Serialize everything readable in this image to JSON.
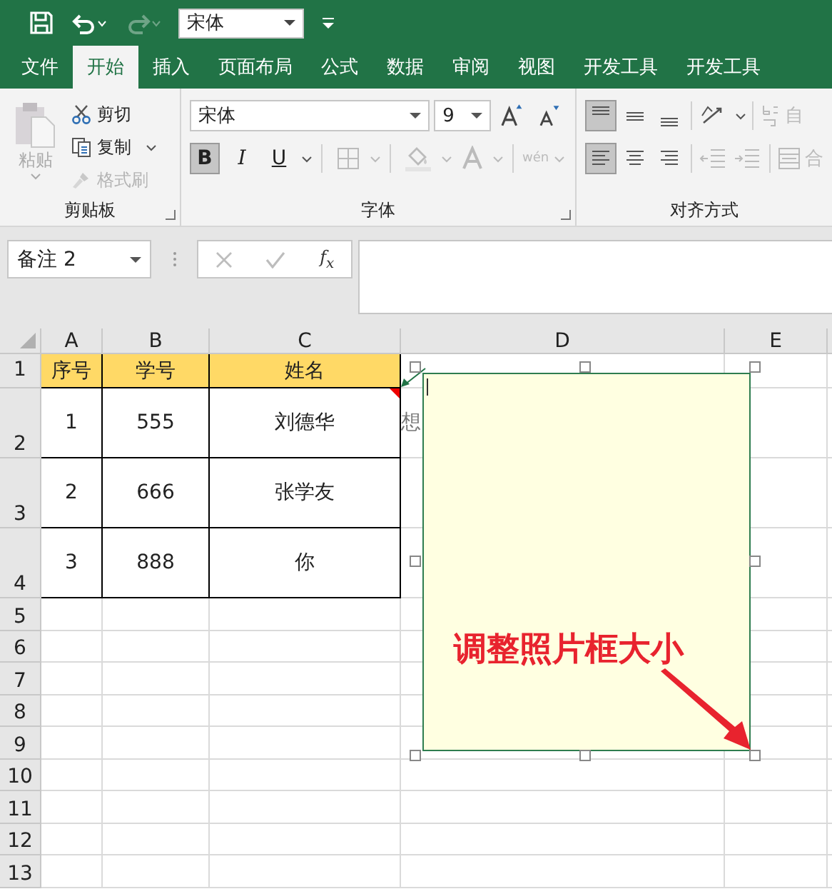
{
  "quick_access": {
    "font": "宋体",
    "redo_disabled": true
  },
  "tabs": [
    {
      "label": "文件",
      "selected": false
    },
    {
      "label": "开始",
      "selected": true
    },
    {
      "label": "插入",
      "selected": false
    },
    {
      "label": "页面布局",
      "selected": false
    },
    {
      "label": "公式",
      "selected": false
    },
    {
      "label": "数据",
      "selected": false
    },
    {
      "label": "审阅",
      "selected": false
    },
    {
      "label": "视图",
      "selected": false
    },
    {
      "label": "开发工具",
      "selected": false
    },
    {
      "label": "开发工具",
      "selected": false
    }
  ],
  "clipboard": {
    "label": "剪贴板",
    "paste": "粘贴",
    "cut": "剪切",
    "copy": "复制",
    "format_painter": "格式刷",
    "format_painter_disabled": true
  },
  "font": {
    "label": "字体",
    "name": "宋体",
    "size": "9",
    "styles": [
      {
        "kind": "bold",
        "label": "B",
        "pressed": true
      },
      {
        "kind": "italic",
        "label": "I",
        "pressed": false
      },
      {
        "kind": "underline",
        "label": "U",
        "pressed": false
      }
    ],
    "phonetic": "wén"
  },
  "alignment": {
    "label": "对齐方式",
    "top": true,
    "middle": false,
    "bottom": false,
    "left": true,
    "center": false,
    "right": false,
    "wrap": "自",
    "merge": "合"
  },
  "formula_bar": {
    "name_box": "备注 2",
    "fx": "f$_{x}$",
    "cancel_disabled": true,
    "enter_disabled": true
  },
  "columns": [
    "A",
    "B",
    "C",
    "D",
    "E"
  ],
  "rows": [
    {
      "number": "1",
      "header": true,
      "cells": [
        "序号",
        "学号",
        "姓名"
      ]
    },
    {
      "number": "2",
      "header": false,
      "cells": [
        "1",
        "555",
        "刘德华"
      ],
      "note": "想",
      "comment_mark": true
    },
    {
      "number": "3",
      "header": false,
      "cells": [
        "2",
        "666",
        "张学友"
      ]
    },
    {
      "number": "4",
      "header": false,
      "cells": [
        "3",
        "888",
        "你"
      ]
    },
    {
      "number": "5"
    },
    {
      "number": "6"
    },
    {
      "number": "7"
    },
    {
      "number": "8"
    },
    {
      "number": "9"
    },
    {
      "number": "10"
    },
    {
      "number": "11"
    },
    {
      "number": "12"
    },
    {
      "number": "13"
    }
  ],
  "comment": {
    "annotation": "调整照片框大小"
  }
}
